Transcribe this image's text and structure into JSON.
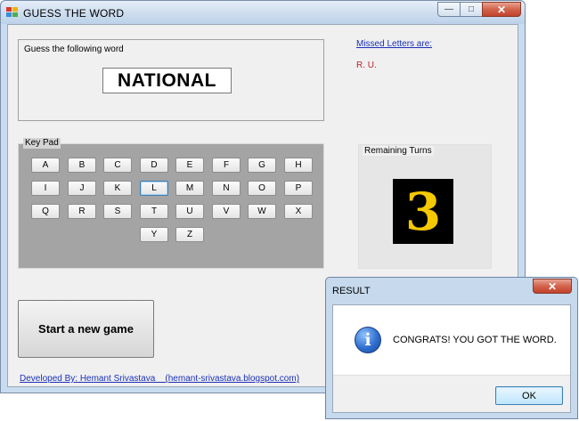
{
  "window": {
    "title": "GUESS THE WORD",
    "minimize_glyph": "—",
    "maximize_glyph": "□",
    "close_glyph": "✕"
  },
  "guess": {
    "label": "Guess the following word",
    "word": "NATIONAL"
  },
  "missed": {
    "title": "Missed Letters are:",
    "letters": "R. U."
  },
  "keypad": {
    "legend": "Key Pad",
    "rows": [
      [
        "A",
        "B",
        "C",
        "D",
        "E",
        "F",
        "G",
        "H"
      ],
      [
        "I",
        "J",
        "K",
        "L",
        "M",
        "N",
        "O",
        "P"
      ],
      [
        "Q",
        "R",
        "S",
        "T",
        "U",
        "V",
        "W",
        "X"
      ],
      [
        "Y",
        "Z"
      ]
    ],
    "focused_key": "L"
  },
  "turns": {
    "legend": "Remaining Turns",
    "value": "3",
    "digit_color": "#f5c800"
  },
  "start_button": {
    "label": "Start a new game"
  },
  "developer": {
    "text": "Developed By: Hemant Srivastava    (hemant-srivastava.blogspot.com)"
  },
  "dialog": {
    "title": "RESULT",
    "close_glyph": "✕",
    "icon": "info-icon",
    "icon_glyph": "i",
    "message": "CONGRATS! YOU GOT THE WORD.",
    "ok_label": "OK"
  },
  "colors": {
    "link": "#1a30b8",
    "missed_letters": "#c0202a",
    "keypad_bg": "#a4a4a4"
  }
}
